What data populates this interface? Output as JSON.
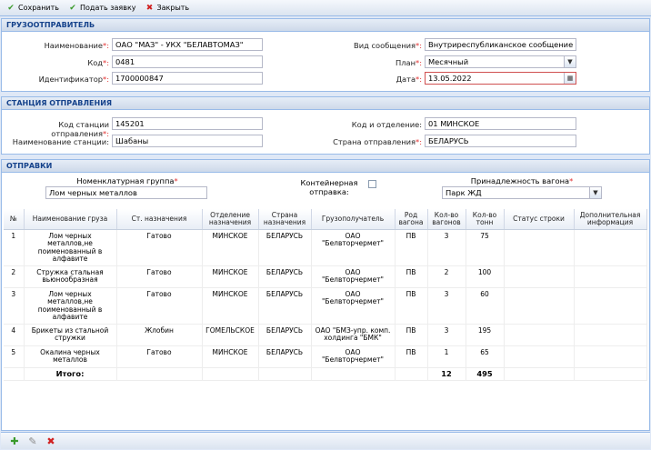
{
  "toolbar": {
    "save_label": "Сохранить",
    "submit_label": "Подать заявку",
    "close_label": "Закрыть"
  },
  "shipper": {
    "header": "ГРУЗООТПРАВИТЕЛЬ",
    "name_label": "Наименование",
    "name_value": "ОАО \"МАЗ\" - УКХ \"БЕЛАВТОМАЗ\"",
    "code_label": "Код",
    "code_value": "0481",
    "id_label": "Идентификатор",
    "id_value": "1700000847",
    "message_type_label": "Вид сообщения",
    "message_type_value": "Внутриреспубликанское сообщение",
    "plan_label": "План",
    "plan_value": "Месячный",
    "date_label": "Дата",
    "date_value": "13.05.2022"
  },
  "station": {
    "header": "СТАНЦИЯ ОТПРАВЛЕНИЯ",
    "code_label": "Код станции отправления",
    "code_value": "145201",
    "name_label": "Наименование станции",
    "name_value": "Шабаны",
    "dept_label": "Код и отделение",
    "dept_value": "01 МИНСКОЕ",
    "country_label": "Страна отправления",
    "country_value": "БЕЛАРУСЬ"
  },
  "shipments": {
    "header": "ОТПРАВКИ",
    "nomenclature_label": "Номенклатурная группа",
    "nomenclature_value": "Лом черных металлов",
    "container_label_1": "Контейнерная",
    "container_label_2": "отправка:",
    "wagon_owner_label": "Принадлежность вагона",
    "wagon_owner_value": "Парк ЖД",
    "columns": [
      "№",
      "Наименование груза",
      "Ст. назначения",
      "Отделение назначения",
      "Страна назначения",
      "Грузополучатель",
      "Род вагона",
      "Кол-во вагонов",
      "Кол-во тонн",
      "Статус строки",
      "Дополнительная информация"
    ],
    "rows": [
      {
        "n": "1",
        "cargo": "Лом черных металлов,не поименованный в алфавите",
        "station": "Гатово",
        "dept": "МИНСКОЕ",
        "country": "БЕЛАРУСЬ",
        "consignee": "ОАО \"Белвторчермет\"",
        "wagon": "ПВ",
        "wagons": "3",
        "tons": "75",
        "status": "",
        "info": ""
      },
      {
        "n": "2",
        "cargo": "Стружка стальная вьюнообразная",
        "station": "Гатово",
        "dept": "МИНСКОЕ",
        "country": "БЕЛАРУСЬ",
        "consignee": "ОАО \"Белвторчермет\"",
        "wagon": "ПВ",
        "wagons": "2",
        "tons": "100",
        "status": "",
        "info": ""
      },
      {
        "n": "3",
        "cargo": "Лом черных металлов,не поименованный в алфавите",
        "station": "Гатово",
        "dept": "МИНСКОЕ",
        "country": "БЕЛАРУСЬ",
        "consignee": "ОАО \"Белвторчермет\"",
        "wagon": "ПВ",
        "wagons": "3",
        "tons": "60",
        "status": "",
        "info": ""
      },
      {
        "n": "4",
        "cargo": "Брикеты из стальной стружки",
        "station": "Жлобин",
        "dept": "ГОМЕЛЬСКОЕ",
        "country": "БЕЛАРУСЬ",
        "consignee": "ОАО \"БМЗ-упр. комп. холдинга \"БМК\"",
        "wagon": "ПВ",
        "wagons": "3",
        "tons": "195",
        "status": "",
        "info": ""
      },
      {
        "n": "5",
        "cargo": "Окалина черных металлов",
        "station": "Гатово",
        "dept": "МИНСКОЕ",
        "country": "БЕЛАРУСЬ",
        "consignee": "ОАО \"Белвторчермет\"",
        "wagon": "ПВ",
        "wagons": "1",
        "tons": "65",
        "status": "",
        "info": ""
      }
    ],
    "total_label": "Итого:",
    "total_wagons": "12",
    "total_tons": "495"
  },
  "required_mark": "*:",
  "colon": ":"
}
